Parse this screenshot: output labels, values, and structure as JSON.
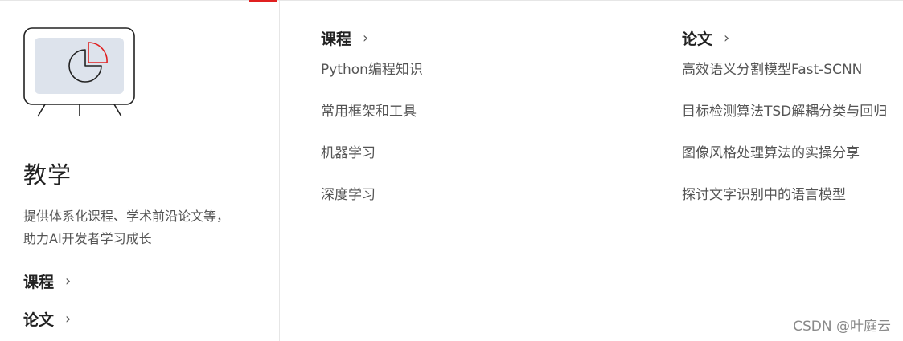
{
  "section": {
    "title": "教学",
    "description": "提供体系化课程、学术前沿论文等，助力AI开发者学习成长",
    "links": [
      {
        "label": "课程",
        "chevron": "›"
      },
      {
        "label": "论文",
        "chevron": "›"
      }
    ],
    "illustration_icon": "presentation-board-pie-chart-icon"
  },
  "columns": [
    {
      "heading": "课程",
      "chevron": "›",
      "items": [
        "Python编程知识",
        "常用框架和工具",
        "机器学习",
        "深度学习"
      ]
    },
    {
      "heading": "论文",
      "chevron": "›",
      "items": [
        "高效语义分割模型Fast-SCNN",
        "目标检测算法TSD解耦分类与回归",
        "图像风格处理算法的实操分享",
        "探讨文字识别中的语言模型"
      ]
    }
  ],
  "watermark": "CSDN @叶庭云",
  "colors": {
    "accent": "#e02020",
    "board_fill": "#dde3ec",
    "text_dark": "#222222",
    "text_muted": "#555555"
  }
}
